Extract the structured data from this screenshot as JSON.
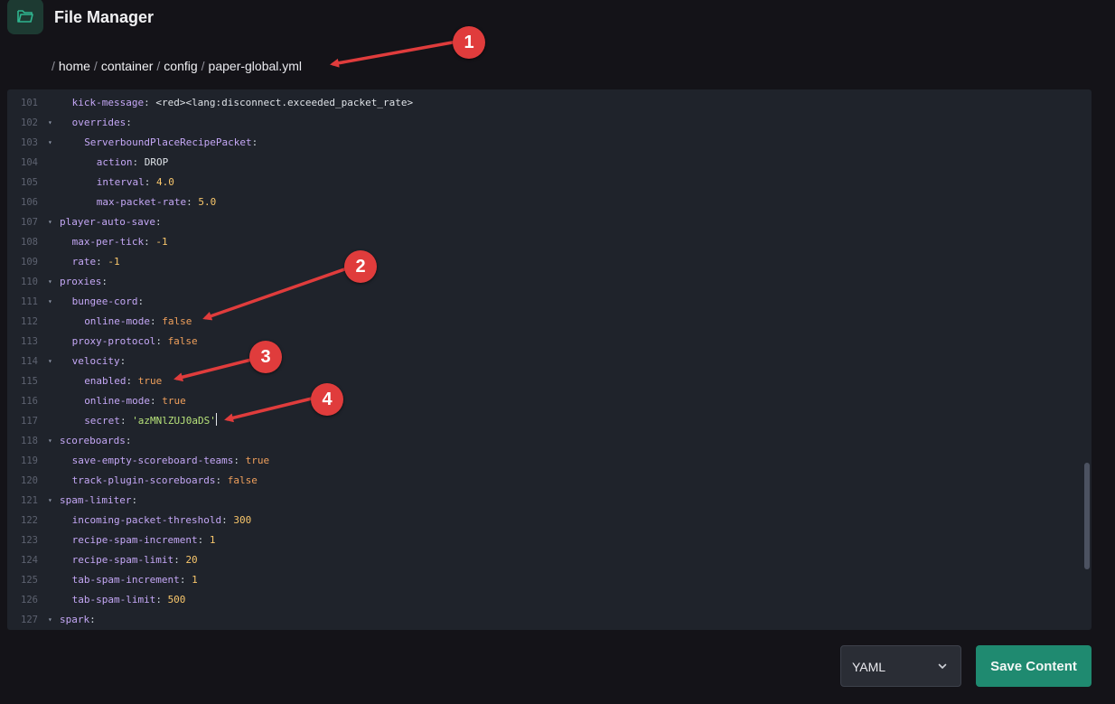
{
  "app": {
    "title": "File Manager",
    "icon": "folder-open-icon"
  },
  "breadcrumb": [
    {
      "label": "home"
    },
    {
      "label": "container"
    },
    {
      "label": "config"
    },
    {
      "label": "paper-global.yml"
    }
  ],
  "editor": {
    "lines": [
      {
        "num": "101",
        "fold": false,
        "indent": 2,
        "key": "kick-message",
        "value": "<red><lang:disconnect.exceeded_packet_rate>",
        "vtype": "text"
      },
      {
        "num": "102",
        "fold": true,
        "indent": 2,
        "key": "overrides",
        "value": "",
        "vtype": ""
      },
      {
        "num": "103",
        "fold": true,
        "indent": 4,
        "key": "ServerboundPlaceRecipePacket",
        "value": "",
        "vtype": ""
      },
      {
        "num": "104",
        "fold": false,
        "indent": 6,
        "key": "action",
        "value": "DROP",
        "vtype": "text"
      },
      {
        "num": "105",
        "fold": false,
        "indent": 6,
        "key": "interval",
        "value": "4.0",
        "vtype": "num"
      },
      {
        "num": "106",
        "fold": false,
        "indent": 6,
        "key": "max-packet-rate",
        "value": "5.0",
        "vtype": "num"
      },
      {
        "num": "107",
        "fold": true,
        "indent": 0,
        "key": "player-auto-save",
        "value": "",
        "vtype": ""
      },
      {
        "num": "108",
        "fold": false,
        "indent": 2,
        "key": "max-per-tick",
        "value": "-1",
        "vtype": "num"
      },
      {
        "num": "109",
        "fold": false,
        "indent": 2,
        "key": "rate",
        "value": "-1",
        "vtype": "num"
      },
      {
        "num": "110",
        "fold": true,
        "indent": 0,
        "key": "proxies",
        "value": "",
        "vtype": ""
      },
      {
        "num": "111",
        "fold": true,
        "indent": 2,
        "key": "bungee-cord",
        "value": "",
        "vtype": ""
      },
      {
        "num": "112",
        "fold": false,
        "indent": 4,
        "key": "online-mode",
        "value": "false",
        "vtype": "bool"
      },
      {
        "num": "113",
        "fold": false,
        "indent": 2,
        "key": "proxy-protocol",
        "value": "false",
        "vtype": "bool"
      },
      {
        "num": "114",
        "fold": true,
        "indent": 2,
        "key": "velocity",
        "value": "",
        "vtype": ""
      },
      {
        "num": "115",
        "fold": false,
        "indent": 4,
        "key": "enabled",
        "value": "true",
        "vtype": "bool"
      },
      {
        "num": "116",
        "fold": false,
        "indent": 4,
        "key": "online-mode",
        "value": "true",
        "vtype": "bool"
      },
      {
        "num": "117",
        "fold": false,
        "indent": 4,
        "key": "secret",
        "value": "'azMNlZUJ0aDS'",
        "vtype": "str",
        "cursor": true
      },
      {
        "num": "118",
        "fold": true,
        "indent": 0,
        "key": "scoreboards",
        "value": "",
        "vtype": ""
      },
      {
        "num": "119",
        "fold": false,
        "indent": 2,
        "key": "save-empty-scoreboard-teams",
        "value": "true",
        "vtype": "bool"
      },
      {
        "num": "120",
        "fold": false,
        "indent": 2,
        "key": "track-plugin-scoreboards",
        "value": "false",
        "vtype": "bool"
      },
      {
        "num": "121",
        "fold": true,
        "indent": 0,
        "key": "spam-limiter",
        "value": "",
        "vtype": ""
      },
      {
        "num": "122",
        "fold": false,
        "indent": 2,
        "key": "incoming-packet-threshold",
        "value": "300",
        "vtype": "num"
      },
      {
        "num": "123",
        "fold": false,
        "indent": 2,
        "key": "recipe-spam-increment",
        "value": "1",
        "vtype": "num"
      },
      {
        "num": "124",
        "fold": false,
        "indent": 2,
        "key": "recipe-spam-limit",
        "value": "20",
        "vtype": "num"
      },
      {
        "num": "125",
        "fold": false,
        "indent": 2,
        "key": "tab-spam-increment",
        "value": "1",
        "vtype": "num"
      },
      {
        "num": "126",
        "fold": false,
        "indent": 2,
        "key": "tab-spam-limit",
        "value": "500",
        "vtype": "num"
      },
      {
        "num": "127",
        "fold": true,
        "indent": 0,
        "key": "spark",
        "value": "",
        "vtype": ""
      }
    ]
  },
  "footer": {
    "language_select": {
      "value": "YAML",
      "icon": "chevron-down-icon"
    },
    "save_label": "Save Content"
  },
  "annotations": [
    "1",
    "2",
    "3",
    "4"
  ],
  "colors": {
    "accent": "#1f8a70",
    "annotation": "#e03c3c",
    "background": "#141318",
    "editor_bg": "#1f232b"
  }
}
